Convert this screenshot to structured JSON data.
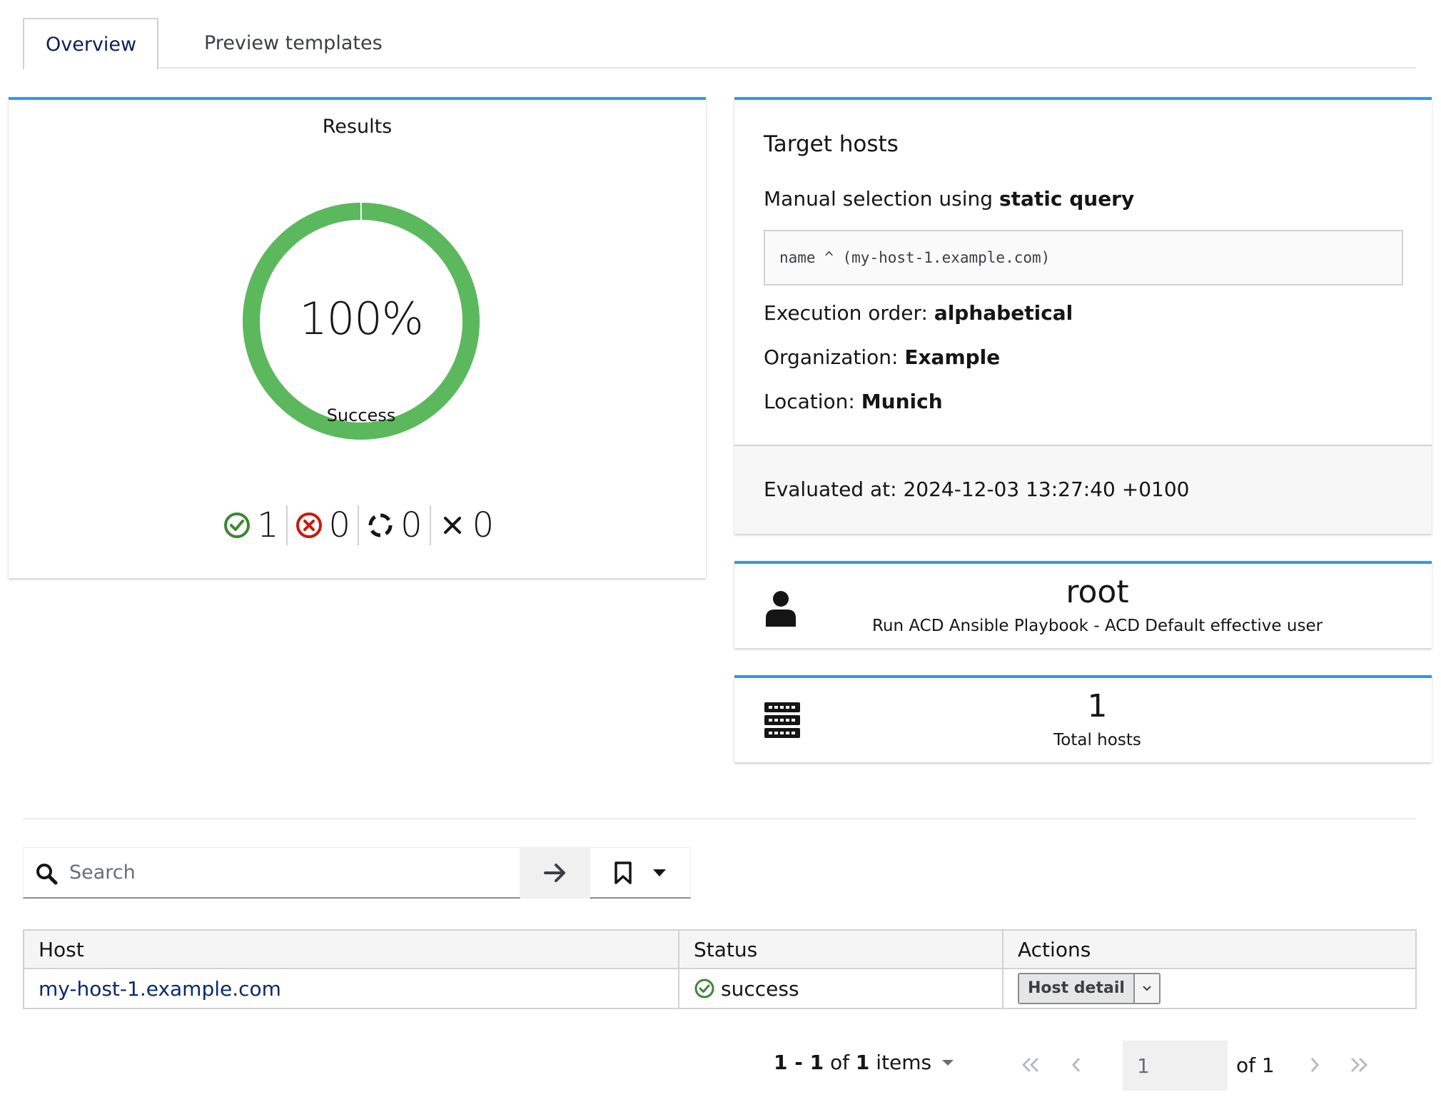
{
  "tabs": [
    {
      "label": "Overview",
      "active": true
    },
    {
      "label": "Preview templates",
      "active": false
    }
  ],
  "results": {
    "title": "Results",
    "percent": "100%",
    "percent_label": "Success",
    "success_fraction": 1.0,
    "colors": {
      "success": "#5cb85c",
      "failed": "#c9190b",
      "pending": "#151515"
    },
    "legend": [
      {
        "icon": "check-circle-icon",
        "count": "1"
      },
      {
        "icon": "error-circle-icon",
        "count": "0"
      },
      {
        "icon": "spinner-icon",
        "count": "0"
      },
      {
        "icon": "times-icon",
        "count": "0"
      }
    ]
  },
  "target": {
    "title": "Target hosts",
    "selection_prefix": "Manual selection using",
    "selection_value": "static query",
    "query": "name ^ (my-host-1.example.com)",
    "execution_order_label": "Execution order:",
    "execution_order_value": "alphabetical",
    "organization_label": "Organization:",
    "organization_value": "Example",
    "location_label": "Location:",
    "location_value": "Munich",
    "evaluated": "Evaluated at: 2024-12-03 13:27:40 +0100"
  },
  "user_card": {
    "icon": "user-icon",
    "value": "root",
    "subtitle": "Run ACD Ansible Playbook - ACD Default effective user"
  },
  "hosts_card": {
    "icon": "server-icon",
    "value": "1",
    "subtitle": "Total hosts"
  },
  "search": {
    "placeholder": "Search",
    "value": ""
  },
  "table": {
    "headers": {
      "host": "Host",
      "status": "Status",
      "actions": "Actions"
    },
    "rows": [
      {
        "host": "my-host-1.example.com",
        "status": "success",
        "action": "Host detail"
      }
    ]
  },
  "pagination": {
    "range": "1 - 1",
    "of_text": "of",
    "total": "1",
    "items_text": "items",
    "page": "1",
    "of_pages": "of 1"
  }
}
